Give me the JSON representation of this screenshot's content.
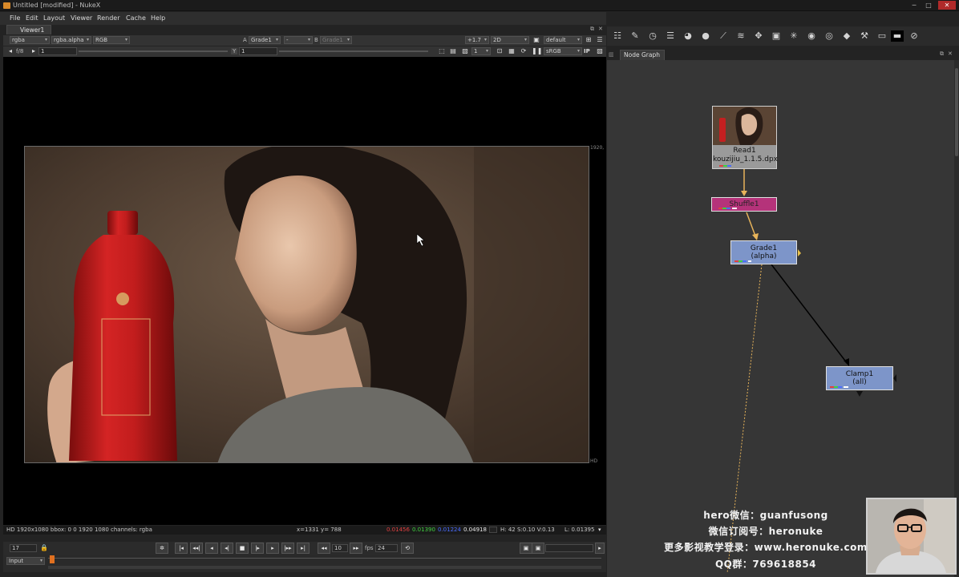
{
  "window": {
    "title": "Untitled [modified] - NukeX"
  },
  "menu": [
    "File",
    "Edit",
    "Layout",
    "Viewer",
    "Render",
    "Cache",
    "Help"
  ],
  "viewer": {
    "tab": "Viewer1",
    "channels": "rgba",
    "alpha_channel": "rgba.alpha",
    "display_channels": "RGB",
    "input_a_label": "A",
    "input_a": "Grade1",
    "compare_mode": "-",
    "input_b_label": "B",
    "input_b": "Grade1",
    "gain": "+1.7",
    "view_mode": "2D",
    "lut_preset": "default",
    "fstop": "f/8",
    "gain_value": "1",
    "gamma_label": "Y",
    "gamma_value": "1",
    "proxy_ratio": "1",
    "colorspace": "sRGB",
    "ip_label": "IP",
    "format_corner": "1920,",
    "format_hd": "HD"
  },
  "status": {
    "format": "HD 1920x1080  bbox: 0 0 1920 1080  channels: rgba",
    "coords": "x=1331 y= 788",
    "r": "0.01456",
    "g": "0.01390",
    "b": "0.01224",
    "a": "0.04918",
    "hsv": "H: 42 S:0.10 V:0.13",
    "lum": "L: 0.01395",
    "colors": {
      "r": "#e04040",
      "g": "#40d040",
      "b": "#4a6cff",
      "a": "#e8e8e8"
    }
  },
  "timeline": {
    "current_frame": "17",
    "increment": "10",
    "fps_label": "fps",
    "fps": "24",
    "input_mode": "Input"
  },
  "node_graph": {
    "tab": "Node Graph",
    "nodes": {
      "read": {
        "name": "Read1",
        "file": "kouzijiu_1.1.5.dpx",
        "color": "#9a9a9a"
      },
      "shuffle": {
        "name": "Shuffle1",
        "color": "#b5337a"
      },
      "grade": {
        "name": "Grade1",
        "mask": "(alpha)",
        "color": "#7d95c9"
      },
      "clamp": {
        "name": "Clamp1",
        "mask": "(all)",
        "color": "#7d95c9"
      }
    }
  },
  "watermark": {
    "line1": "hero微信：guanfusong",
    "line2": "微信订阅号：heronuke",
    "line3": "更多影视教学登录：www.heronuke.com",
    "line4": "QQ群：769618854"
  },
  "icons": {
    "right_toolbar": [
      "properties-icon",
      "draw-icon",
      "time-icon",
      "channel-icon",
      "color-icon",
      "filter-icon",
      "keyer-icon",
      "merge-icon",
      "transform-icon",
      "3d-icon",
      "particles-icon",
      "deep-icon",
      "views-icon",
      "metadata-icon",
      "toolsets-icon",
      "other-icon",
      "furnace-icon",
      "furnacecore-icon"
    ]
  }
}
